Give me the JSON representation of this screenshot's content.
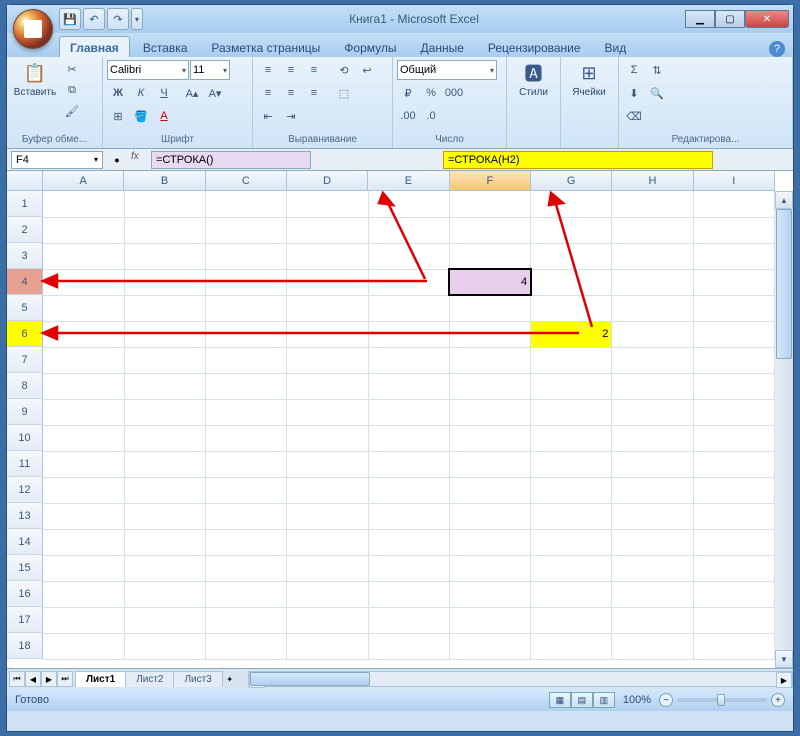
{
  "app": {
    "title": "Книга1 - Microsoft Excel"
  },
  "qat": {
    "save": "💾",
    "undo": "↶",
    "redo": "↷"
  },
  "wincontrols": {
    "min": "▁",
    "max": "▢",
    "close": "✕"
  },
  "tabs": {
    "home": "Главная",
    "insert": "Вставка",
    "layout": "Разметка страницы",
    "formulas": "Формулы",
    "data": "Данные",
    "review": "Рецензирование",
    "view": "Вид"
  },
  "ribbon": {
    "clipboard": {
      "paste": "Вставить",
      "label": "Буфер обме..."
    },
    "font": {
      "name": "Calibri",
      "size": "11",
      "bold": "Ж",
      "italic": "К",
      "underline": "Ч",
      "label": "Шрифт"
    },
    "align": {
      "label": "Выравнивание"
    },
    "number": {
      "format": "Общий",
      "label": "Число"
    },
    "styles": {
      "btn": "Стили",
      "label": ""
    },
    "cells": {
      "btn": "Ячейки",
      "label": ""
    },
    "editing": {
      "label": "Редактирова..."
    }
  },
  "formulabar": {
    "namebox": "F4",
    "fx": "fx",
    "formula1": "=СТРОКА()",
    "formula2": "=СТРОКА(H2)"
  },
  "columns": [
    "A",
    "B",
    "C",
    "D",
    "E",
    "F",
    "G",
    "H",
    "I"
  ],
  "rows": [
    "1",
    "2",
    "3",
    "4",
    "5",
    "6",
    "7",
    "8",
    "9",
    "10",
    "11",
    "12",
    "13",
    "14",
    "15",
    "16",
    "17",
    "18"
  ],
  "cells": {
    "F4": "4",
    "G6": "2"
  },
  "sheets": {
    "s1": "Лист1",
    "s2": "Лист2",
    "s3": "Лист3"
  },
  "status": {
    "ready": "Готово",
    "zoom": "100%"
  }
}
